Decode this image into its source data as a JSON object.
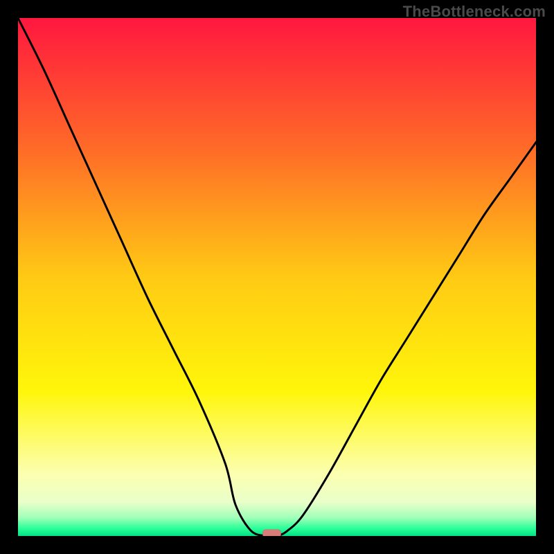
{
  "watermark": "TheBottleneck.com",
  "chart_data": {
    "type": "line",
    "title": "",
    "xlabel": "",
    "ylabel": "",
    "xlim": [
      0,
      100
    ],
    "ylim": [
      0,
      100
    ],
    "x": [
      0,
      5,
      10,
      15,
      20,
      25,
      30,
      35,
      40,
      42,
      45,
      48,
      50,
      52,
      55,
      60,
      65,
      70,
      75,
      80,
      85,
      90,
      95,
      100
    ],
    "values": [
      100,
      90,
      79,
      68,
      57,
      46,
      36,
      26,
      14,
      6,
      1,
      0,
      0,
      1,
      4,
      12,
      21,
      30,
      38,
      46,
      54,
      62,
      69,
      76
    ],
    "minimum_x": 49,
    "marker": {
      "x": 49,
      "y": 0.5
    },
    "gradient_stops": [
      {
        "offset": 0.0,
        "color": "#ff173f"
      },
      {
        "offset": 0.25,
        "color": "#ff6a28"
      },
      {
        "offset": 0.5,
        "color": "#ffca14"
      },
      {
        "offset": 0.72,
        "color": "#fff60a"
      },
      {
        "offset": 0.88,
        "color": "#fcffb0"
      },
      {
        "offset": 0.935,
        "color": "#e9ffca"
      },
      {
        "offset": 0.965,
        "color": "#9fffb8"
      },
      {
        "offset": 0.985,
        "color": "#2dff9a"
      },
      {
        "offset": 1.0,
        "color": "#00e184"
      }
    ]
  }
}
